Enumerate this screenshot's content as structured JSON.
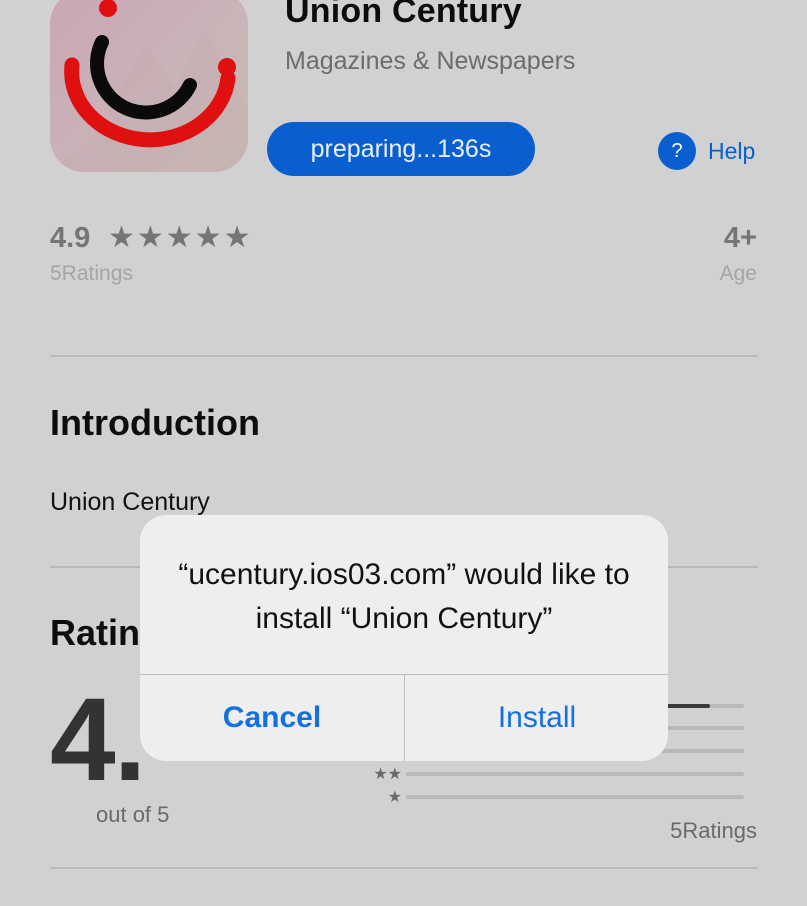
{
  "app": {
    "title": "Union Century",
    "category": "Magazines & Newspapers",
    "action_label": "preparing...136s",
    "help_label": "Help",
    "help_glyph": "?",
    "icon": "union-century-logo"
  },
  "stats": {
    "rating": "4.9",
    "stars": "★★★★★",
    "rating_count": "5Ratings",
    "age": "4+",
    "age_label": "Age"
  },
  "introduction": {
    "heading": "Introduction",
    "text": "Union Century"
  },
  "ratings": {
    "heading": "Ratin",
    "big_value": "4.",
    "out_of": "out of 5",
    "total": "5Ratings",
    "bars": [
      {
        "stars": "★★★★★",
        "fraction": 0.9
      },
      {
        "stars": "★★★★",
        "fraction": 0.0
      },
      {
        "stars": "★★★",
        "fraction": 0.0
      },
      {
        "stars": "★★",
        "fraction": 0.0
      },
      {
        "stars": "★",
        "fraction": 0.0
      }
    ]
  },
  "alert": {
    "message": "“ucentury.ios03.com” would like to install “Union Century”",
    "cancel_label": "Cancel",
    "install_label": "Install"
  },
  "colors": {
    "accent": "#0a5fd0",
    "alert_button": "#1270e3",
    "logo_red": "#e01010",
    "logo_black": "#0a0a0a"
  }
}
